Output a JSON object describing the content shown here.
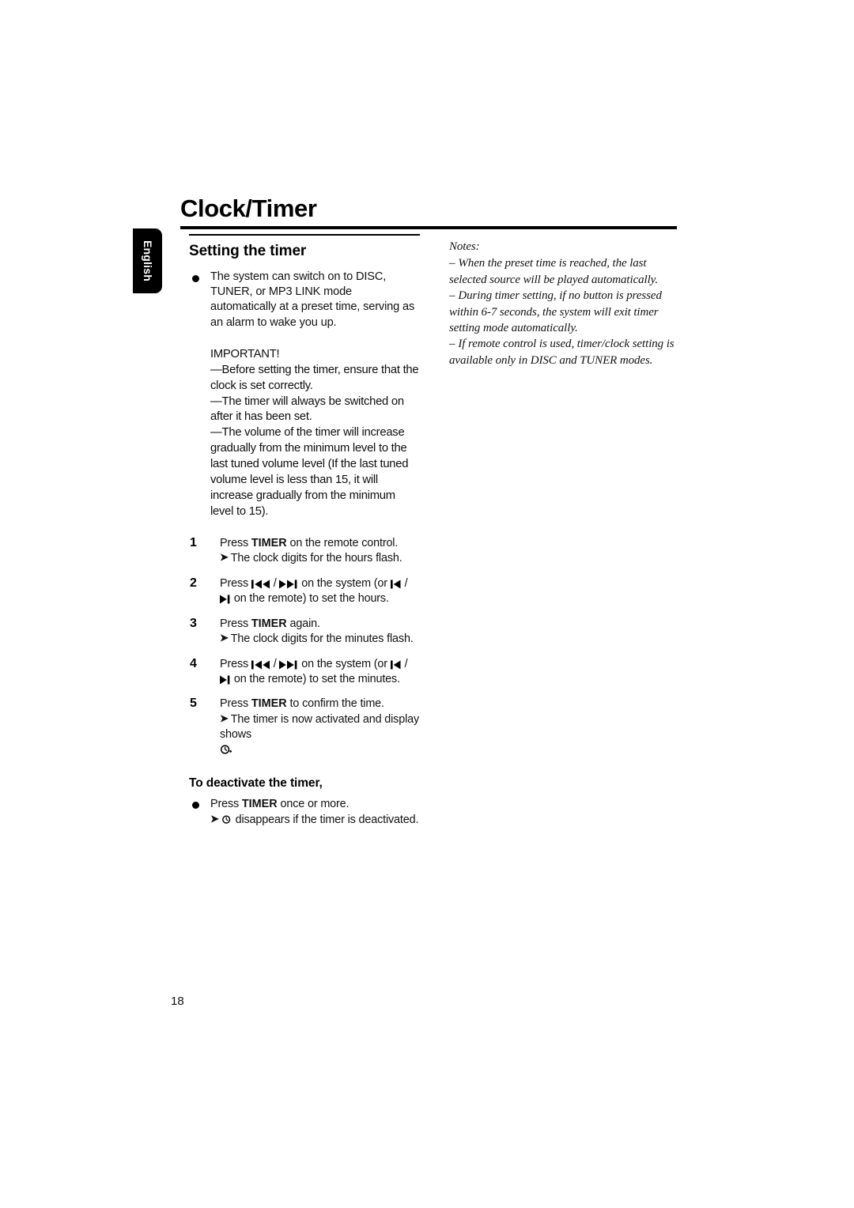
{
  "page": {
    "chapter_title": "Clock/Timer",
    "language_tab": "English",
    "page_number": "18"
  },
  "left_column": {
    "section_heading": "Setting the timer",
    "intro_bullet": "The system can switch on to DISC, TUNER, or MP3 LINK mode automatically at a preset time, serving as an alarm to wake you up.",
    "important": {
      "label": "IMPORTANT!",
      "lines": [
        "—Before setting the timer, ensure that the clock is set correctly.",
        "—The timer will always be switched on after it has been set.",
        "—The volume of the timer will increase gradually from the minimum level to the last tuned volume level (If the last tuned volume level is less than 15, it will increase gradually from the minimum level to 15)."
      ]
    },
    "steps": [
      {
        "number": "1",
        "pre": "Press ",
        "bold": "TIMER",
        "post": " on the remote control.",
        "result": "The clock digits for the hours flash."
      },
      {
        "number": "2",
        "pre": "Press ",
        "glyph_prev": "prev-track-icon",
        "sep": " / ",
        "glyph_next": "next-track-icon",
        "mid": " on the system (or ",
        "glyph_prev_remote": "prev-track-remote-icon",
        "sep2": " / ",
        "glyph_next_remote": "next-track-remote-icon",
        "post": " on the remote) to set the hours."
      },
      {
        "number": "3",
        "pre": "Press ",
        "bold": "TIMER",
        "post": " again.",
        "result": "The clock digits for the minutes flash."
      },
      {
        "number": "4",
        "pre": "Press ",
        "glyph_prev": "prev-track-icon",
        "sep": " / ",
        "glyph_next": "next-track-icon",
        "mid": " on the system (or ",
        "glyph_prev_remote": "prev-track-remote-icon",
        "sep2": " / ",
        "glyph_next_remote": "next-track-remote-icon",
        "post": " on the remote) to set the minutes."
      },
      {
        "number": "5",
        "pre": "Press ",
        "bold": "TIMER",
        "post": " to confirm the time.",
        "result": "The timer is now activated and display shows",
        "result_icon": "timer-clock-icon"
      }
    ],
    "deactivate": {
      "heading": "To deactivate the timer,",
      "pre": "Press ",
      "bold": "TIMER",
      "post": " once or more.",
      "result_icon": "timer-clock-icon",
      "result": " disappears if the timer is deactivated."
    }
  },
  "right_column": {
    "notes_label": "Notes:",
    "notes": [
      "When the preset time is reached, the last selected source will be played automatically.",
      "During timer setting, if no button is pressed within 6-7 seconds, the system will exit timer setting mode automatically.",
      "If remote control is used, timer/clock setting is available only in DISC and TUNER modes."
    ]
  },
  "colors": {
    "ink": "#000000",
    "paper": "#ffffff",
    "tab_background": "#000000",
    "tab_text": "#ffffff"
  }
}
